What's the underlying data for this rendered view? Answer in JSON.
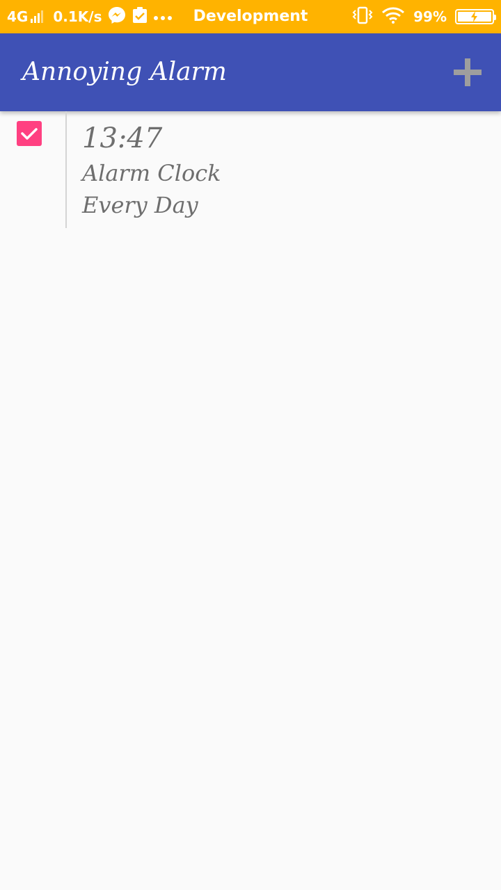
{
  "status_bar": {
    "network": "4G",
    "speed": "0.1K/s",
    "title": "Development",
    "battery": "99%",
    "icons": [
      "signal-icon",
      "messenger-icon",
      "clipboard-check-icon",
      "more-dots-icon",
      "vibrate-icon",
      "wifi-icon",
      "battery-charging-icon"
    ],
    "background": "#ffb300"
  },
  "app_bar": {
    "title": "Annoying Alarm",
    "add_icon": "plus-icon",
    "background": "#3f51b5"
  },
  "alarms": [
    {
      "enabled": true,
      "time": "13:47",
      "label": "Alarm Clock",
      "repeat": "Every Day"
    }
  ],
  "colors": {
    "accent": "#ff4081",
    "primary": "#3f51b5",
    "status": "#ffb300",
    "text_secondary": "#6e6e6e"
  }
}
